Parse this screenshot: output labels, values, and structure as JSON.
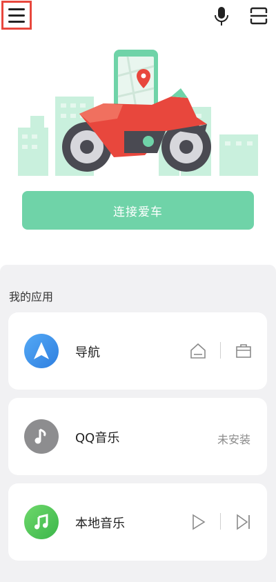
{
  "topbar": {
    "menu_icon": "hamburger-menu-icon",
    "mic_icon": "microphone-icon",
    "scan_icon": "scan-icon"
  },
  "hero": {
    "illustration": "motorcycle-with-phone-map-illustration",
    "connect_label": "连接爱车"
  },
  "apps": {
    "section_title": "我的应用",
    "items": [
      {
        "name": "导航",
        "icon": "navigation-arrow-icon",
        "actions": [
          "home-icon",
          "briefcase-icon"
        ]
      },
      {
        "name": "QQ音乐",
        "icon": "qq-music-note-icon",
        "status": "未安装"
      },
      {
        "name": "本地音乐",
        "icon": "local-music-icon",
        "actions": [
          "play-icon",
          "next-track-icon"
        ]
      }
    ]
  },
  "colors": {
    "accent_green": "#6fd3a8",
    "highlight_red": "#e8473d",
    "panel_bg": "#f1f1f3"
  }
}
